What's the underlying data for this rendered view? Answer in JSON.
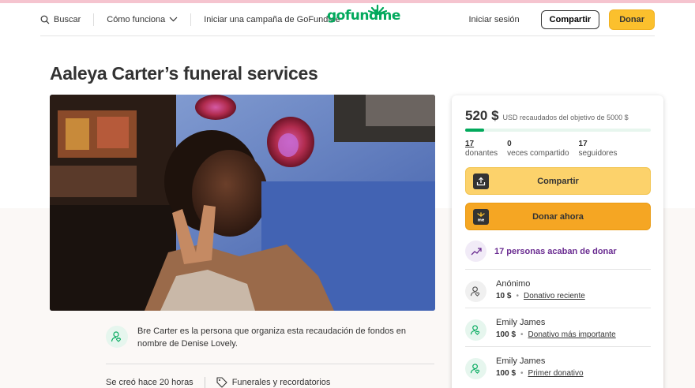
{
  "header": {
    "search_label": "Buscar",
    "how_it_works_label": "Cómo funciona",
    "start_campaign_label": "Iniciar una campaña de GoFundMe",
    "logo_text": "gofundme",
    "login_label": "Iniciar sesión",
    "share_label": "Compartir",
    "donate_label": "Donar"
  },
  "campaign": {
    "title": "Aaleya Carter’s funeral services",
    "organizer_text": "Bre Carter es la persona que organiza esta recaudación de fondos en nombre de Denise Lovely.",
    "created_text": "Se creó hace 20 horas",
    "category_label": "Funerales y recordatorios"
  },
  "donation_card": {
    "raised_amount": "520 $",
    "raised_text": "USD recaudados del objetivo de 5000 $",
    "progress_fraction": 0.104,
    "stats": [
      {
        "value": "17",
        "label": "donantes"
      },
      {
        "value": "0",
        "label": "veces compartido"
      },
      {
        "value": "17",
        "label": "seguidores"
      }
    ],
    "share_button_label": "Compartir",
    "donate_button_label": "Donar ahora",
    "recent_text": "17 personas acaban de donar",
    "donations": [
      {
        "name": "Anónimo",
        "amount": "10 $",
        "tag": "Donativo reciente"
      },
      {
        "name": "Emily James",
        "amount": "100 $",
        "tag": "Donativo más importante"
      },
      {
        "name": "Emily James",
        "amount": "100 $",
        "tag": "Primer donativo"
      }
    ]
  },
  "colors": {
    "brand_green": "#02a95c",
    "donate_yellow": "#fbc02d",
    "donate_orange": "#f5a623",
    "purple": "#6a2c91"
  }
}
